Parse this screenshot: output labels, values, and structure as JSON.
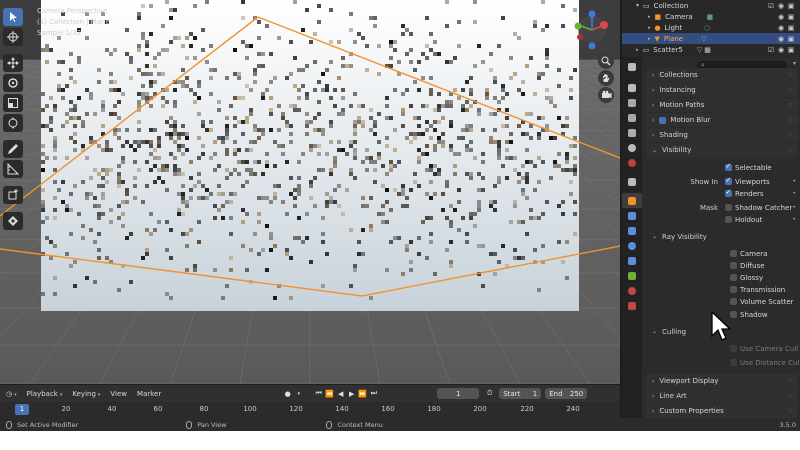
{
  "viewport": {
    "overlay_line1": "Camera Perspective",
    "overlay_line2": "(1) Collection | Plane",
    "overlay_line3": "Sample 1/32"
  },
  "outliner": {
    "rows": [
      {
        "label": "Collection"
      },
      {
        "label": "Camera"
      },
      {
        "label": "Light"
      },
      {
        "label": "Plane"
      },
      {
        "label": "Scatter5"
      }
    ]
  },
  "properties": {
    "panels": {
      "collections": "Collections",
      "instancing": "Instancing",
      "motion_paths": "Motion Paths",
      "motion_blur": "Motion Blur",
      "shading": "Shading",
      "visibility": "Visibility",
      "viewport_display": "Viewport Display",
      "line_art": "Line Art",
      "custom_properties": "Custom Properties"
    },
    "visibility": {
      "selectable": "Selectable",
      "show_in_label": "Show In",
      "viewports": "Viewports",
      "renders": "Renders",
      "mask_label": "Mask",
      "shadow_catcher": "Shadow Catcher",
      "holdout": "Holdout",
      "ray_visibility": "Ray Visibility",
      "camera": "Camera",
      "diffuse": "Diffuse",
      "glossy": "Glossy",
      "transmission": "Transmission",
      "volume_scatter": "Volume Scatter",
      "shadow": "Shadow",
      "culling": "Culling",
      "use_camera_cull": "Use Camera Cull",
      "use_distance_cull": "Use Distance Cull"
    }
  },
  "timeline": {
    "menus": [
      "Playback",
      "Keying",
      "View",
      "Marker"
    ],
    "current_frame": "1",
    "start_label": "Start",
    "start_value": "1",
    "end_label": "End",
    "end_value": "250",
    "ruler": [
      "20",
      "40",
      "60",
      "80",
      "100",
      "120",
      "140",
      "160",
      "180",
      "200",
      "220",
      "240"
    ],
    "ruler_current": "1"
  },
  "statusbar": {
    "left": "Set Active Modifier",
    "middle": "Pan View",
    "right": "Context Menu",
    "version": "3.5.0"
  },
  "colors": {
    "accent": "#4772b3",
    "selection_outline": "#f0922e",
    "panel_bg": "#2b2b2b"
  }
}
